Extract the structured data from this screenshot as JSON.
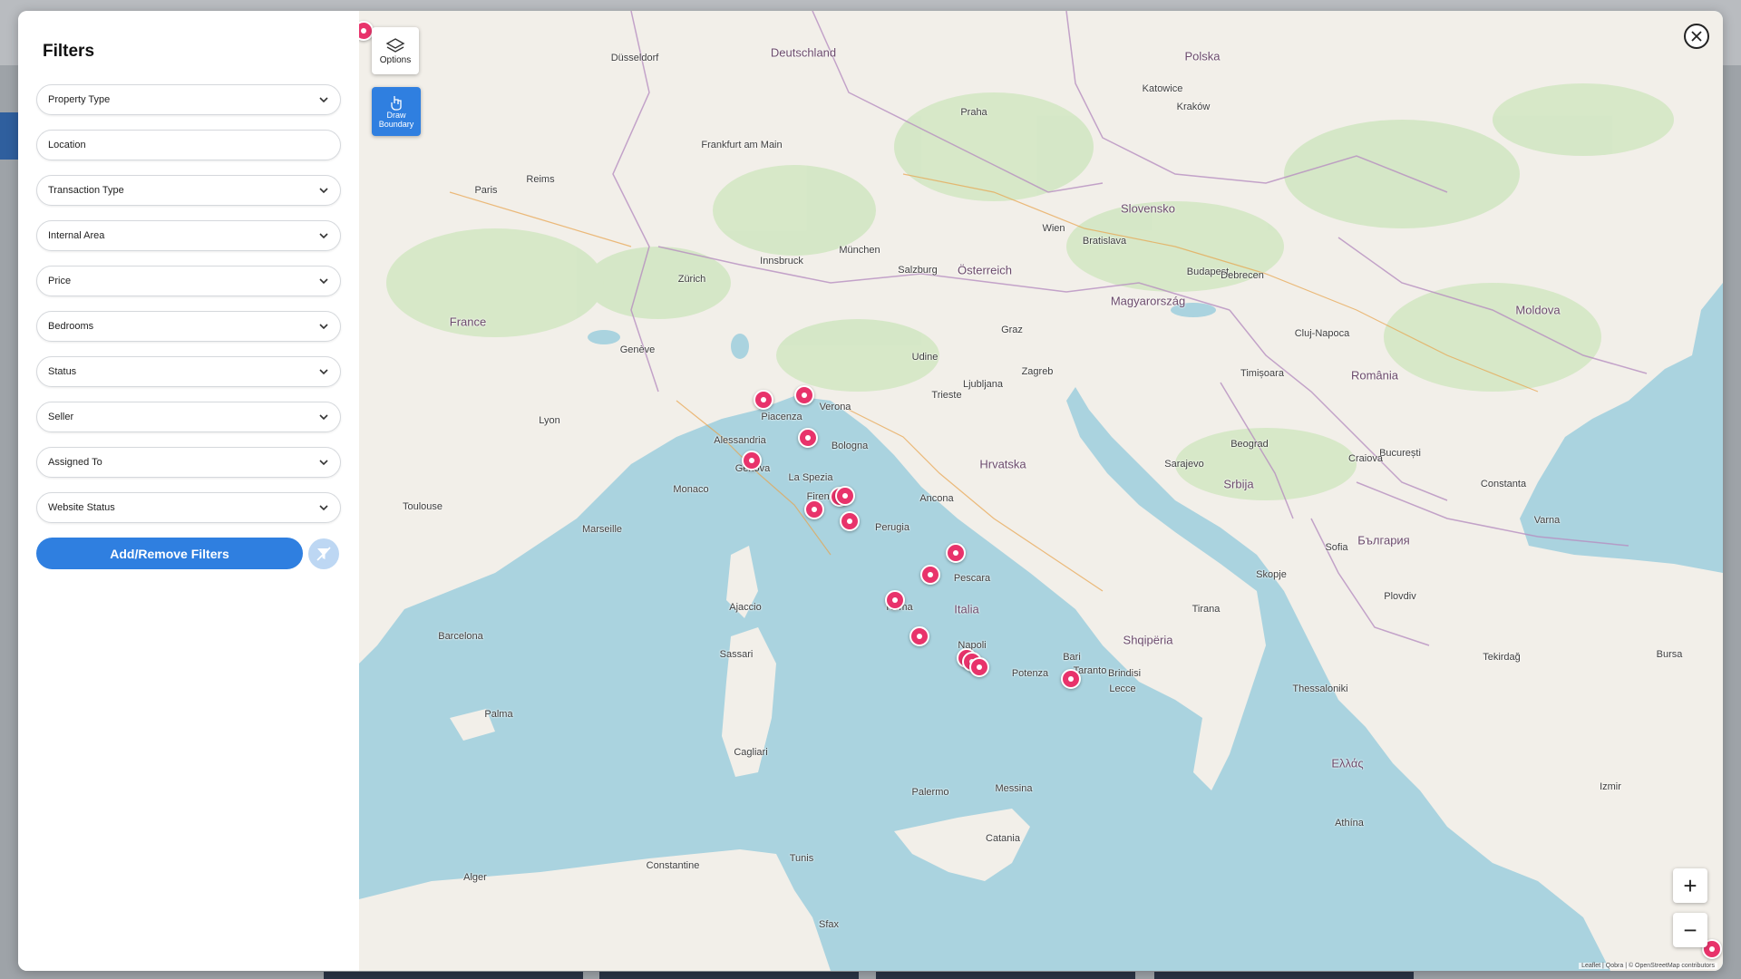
{
  "filters_panel": {
    "title": "Filters",
    "fields": [
      {
        "label": "Property Type",
        "type": "dropdown"
      },
      {
        "label": "Location",
        "type": "input"
      },
      {
        "label": "Transaction Type",
        "type": "dropdown"
      },
      {
        "label": "Internal Area",
        "type": "dropdown"
      },
      {
        "label": "Price",
        "type": "dropdown"
      },
      {
        "label": "Bedrooms",
        "type": "dropdown"
      },
      {
        "label": "Status",
        "type": "dropdown"
      },
      {
        "label": "Seller",
        "type": "dropdown"
      },
      {
        "label": "Assigned To",
        "type": "dropdown"
      },
      {
        "label": "Website Status",
        "type": "dropdown"
      }
    ],
    "add_button": "Add/Remove Filters"
  },
  "map": {
    "options_label": "Options",
    "draw_label_1": "Draw",
    "draw_label_2": "Boundary",
    "zoom_in": "+",
    "zoom_out": "−",
    "attribution": "Leaflet | Qobra | © OpenStreetMap contributors",
    "countries": [
      "Deutschland",
      "France",
      "Italia",
      "Österreich",
      "Hrvatska",
      "Srbija",
      "România",
      "България",
      "Shqipëria",
      "Ελλάς",
      "Slovensko",
      "Magyarország",
      "Polska",
      "Moldova"
    ],
    "cities": [
      "Düsseldorf",
      "Frankfurt am Main",
      "Paris",
      "Reims",
      "München",
      "Zürich",
      "Genève",
      "Lyon",
      "Marseille",
      "Toulouse",
      "Monaco",
      "Bologna",
      "Verona",
      "Piacenza",
      "Alessandria",
      "Genova",
      "La Spezia",
      "Firenze",
      "Perugia",
      "Ancona",
      "Pescara",
      "Roma",
      "Napoli",
      "Potenza",
      "Bari",
      "Taranto",
      "Lecce",
      "Palermo",
      "Messina",
      "Catania",
      "Cagliari",
      "Sassari",
      "Ajaccio",
      "Barcelona",
      "Palma",
      "Alger",
      "Constantine",
      "Tunis",
      "Sfax",
      "Wien",
      "Budapest",
      "Bratislava",
      "Praha",
      "Zagreb",
      "Ljubljana",
      "Sarajevo",
      "Beograd",
      "Skopje",
      "Tirana",
      "Sofia",
      "București",
      "Athína",
      "Kraków",
      "Katowice",
      "Brindisi",
      "Trieste",
      "Udine",
      "Salzburg",
      "Innsbruck",
      "Graz",
      "Debrecen",
      "Cluj-Napoca",
      "Timișoara",
      "Craiova",
      "Constanta",
      "Varna",
      "Plovdiv",
      "Thessaloniki",
      "Izmir",
      "Tekirdağ",
      "Bursa"
    ]
  }
}
